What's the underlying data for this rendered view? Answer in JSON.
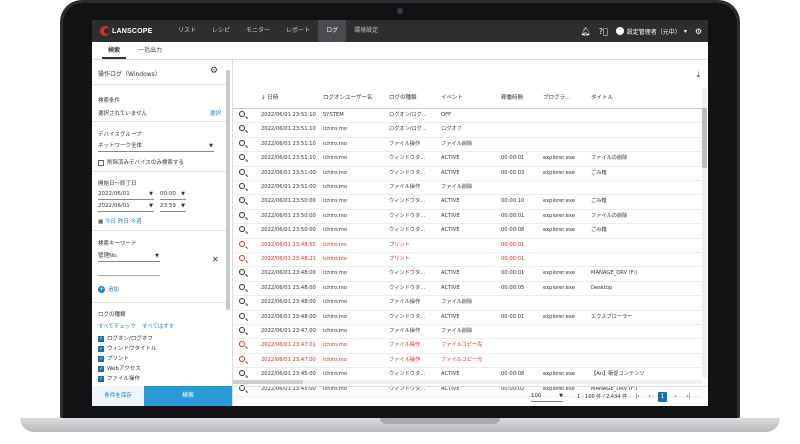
{
  "app": {
    "logo_text": "LANSCOPE",
    "nav": [
      "リスト",
      "レシピ",
      "モニター",
      "レポート",
      "ログ",
      "環境設定"
    ],
    "nav_active_index": 4,
    "icons": [
      "bell-icon",
      "help-icon",
      "user-avatar-icon",
      "gear-icon"
    ],
    "user_label": "設定管理者（元中）",
    "user_caret": "▾"
  },
  "subtabs": [
    "検索",
    "一括出力"
  ],
  "sidebar": {
    "title": "操作ログ（Windows）",
    "condition_label": "検索条件",
    "condition_value": "選択されていません",
    "select_link": "選択",
    "device_group_label": "デバイスグループ",
    "device_group_value": "ネットワーク全体",
    "deleted_only_label": "削除済みデバイスのみ検索する",
    "period_label": "開始日～終了日",
    "date_from": "2022/06/01",
    "time_from": "00:00",
    "date_to": "2022/06/01",
    "time_to": "23:59",
    "quick_today": "今日",
    "quick_yesterday": "昨日",
    "quick_thisweek": "今週",
    "keyword_label": "検索キーワード",
    "keyword_field": "管理No.",
    "add_label": "追加",
    "logtype_label": "ログの種類",
    "check_all": "すべてチェック",
    "uncheck_all": "すべてはずす",
    "logtypes": [
      "ログオン/ログオフ",
      "ウィンドウタイトル",
      "プリント",
      "Webアクセス",
      "ファイル操作"
    ],
    "save_button": "条件を保存",
    "search_button": "検索"
  },
  "table": {
    "columns": [
      "",
      "↓ 日時",
      "ログオンユーザー名",
      "ログの種類",
      "イベント",
      "稼働時間",
      "プログラ…",
      "タイトル"
    ],
    "rows": [
      {
        "t": "2022/06/01 23:51:10",
        "u": "SYSTEM",
        "k": "ログオン/ログ…",
        "e": "OFF",
        "d": "",
        "p": "",
        "ti": "",
        "red": false
      },
      {
        "t": "2022/06/01 23:51:10",
        "u": "ichiro.mo",
        "k": "ログオン/ログ…",
        "e": "ログオフ",
        "d": "",
        "p": "",
        "ti": "",
        "red": false
      },
      {
        "t": "2022/06/01 23:51:10",
        "u": "ichiro.mo",
        "k": "ファイル操作",
        "e": "ファイル削除",
        "d": "",
        "p": "",
        "ti": "",
        "red": false
      },
      {
        "t": "2022/06/01 23:51:10",
        "u": "ichiro.mo",
        "k": "ウィンドウタ…",
        "e": "ACTIVE",
        "d": "00:00:01",
        "p": "explorer.exe",
        "ti": "ファイルの削除",
        "red": false
      },
      {
        "t": "2022/06/01 23:51:00",
        "u": "ichiro.mo",
        "k": "ウィンドウタ…",
        "e": "ACTIVE",
        "d": "00:00:03",
        "p": "explorer.exe",
        "ti": "ごみ箱",
        "red": false
      },
      {
        "t": "2022/06/01 23:51:00",
        "u": "ichiro.mo",
        "k": "ファイル操作",
        "e": "ファイル削除",
        "d": "",
        "p": "",
        "ti": "",
        "red": false
      },
      {
        "t": "2022/06/01 23:50:00",
        "u": "ichiro.mo",
        "k": "ウィンドウタ…",
        "e": "ACTIVE",
        "d": "00:00:10",
        "p": "explorer.exe",
        "ti": "ごみ箱",
        "red": false
      },
      {
        "t": "2022/06/01 23:50:00",
        "u": "ichiro.mo",
        "k": "ウィンドウタ…",
        "e": "ACTIVE",
        "d": "00:00:01",
        "p": "explorer.exe",
        "ti": "ファイルの削除",
        "red": false
      },
      {
        "t": "2022/06/01 23:50:00",
        "u": "ichiro.mo",
        "k": "ウィンドウタ…",
        "e": "ACTIVE",
        "d": "00:00:08",
        "p": "explorer.exe",
        "ti": "ごみ箱",
        "red": false
      },
      {
        "t": "2022/06/01 23:48:55",
        "u": "ichiro.mo",
        "k": "プリント",
        "e": "",
        "d": "00:00:01",
        "p": "",
        "ti": "",
        "red": true
      },
      {
        "t": "2022/06/01 23:48:21",
        "u": "ichiro.mo",
        "k": "プリント",
        "e": "",
        "d": "00:00:01",
        "p": "",
        "ti": "",
        "red": true
      },
      {
        "t": "2022/06/01 23:48:00",
        "u": "ichiro.mo",
        "k": "ウィンドウタ…",
        "e": "ACTIVE",
        "d": "00:00:01",
        "p": "explorer.exe",
        "ti": "MANAGE_DRV (F:)",
        "red": false
      },
      {
        "t": "2022/06/01 23:48:00",
        "u": "ichiro.mo",
        "k": "ウィンドウタ…",
        "e": "ACTIVE",
        "d": "00:00:05",
        "p": "explorer.exe",
        "ti": "Desktop",
        "red": false
      },
      {
        "t": "2022/06/01 23:48:00",
        "u": "ichiro.mo",
        "k": "ファイル操作",
        "e": "ファイル削除",
        "d": "",
        "p": "",
        "ti": "",
        "red": false
      },
      {
        "t": "2022/06/01 23:48:00",
        "u": "ichiro.mo",
        "k": "ウィンドウタ…",
        "e": "ACTIVE",
        "d": "00:00:01",
        "p": "explorer.exe",
        "ti": "エクスプローラー",
        "red": false
      },
      {
        "t": "2022/06/01 23:47:00",
        "u": "ichiro.mo",
        "k": "ファイル操作",
        "e": "ファイル削除",
        "d": "",
        "p": "",
        "ti": "",
        "red": false
      },
      {
        "t": "2022/06/01 23:47:01",
        "u": "ichiro.mo",
        "k": "ファイル操作",
        "e": "ファイルコピー先",
        "d": "",
        "p": "",
        "ti": "",
        "red": true
      },
      {
        "t": "2022/06/01 23:47:00",
        "u": "ichiro.mo",
        "k": "ファイル操作",
        "e": "ファイルコピー元",
        "d": "",
        "p": "",
        "ti": "",
        "red": true
      },
      {
        "t": "2022/06/01 23:45:00",
        "u": "ichiro.mo",
        "k": "ウィンドウタ…",
        "e": "ACTIVE",
        "d": "00:00:08",
        "p": "explorer.exe",
        "ti": "【An】販促コンテンツ",
        "red": false
      },
      {
        "t": "2022/06/01 23:45:00",
        "u": "ichiro.mo",
        "k": "ウィンドウタ…",
        "e": "ACTIVE",
        "d": "00:00:02",
        "p": "explorer.exe",
        "ti": "MANAGE_DRV (F:)",
        "red": false
      }
    ]
  },
  "pager": {
    "page_size": "100",
    "info": "1 - 100 件 / 2,434 件",
    "current_page": "1",
    "first": "|‹",
    "prev": "‹",
    "next": "›",
    "last": "›|"
  },
  "colors": {
    "accent": "#2a9ad6",
    "brand_red": "#d0302f",
    "alert_red": "#e0292a",
    "topbar": "#2d2e30"
  }
}
